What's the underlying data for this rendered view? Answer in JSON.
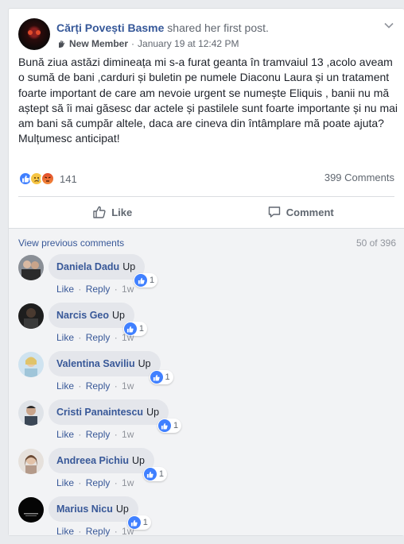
{
  "post": {
    "author": "Cărți Povești Basme",
    "action": "shared her first post.",
    "badge": "New Member",
    "separator": "·",
    "timestamp": "January 19 at 12:42 PM",
    "body": "Bună ziua astăzi dimineața mi s-a furat geanta în tramvaiul 13 ,acolo aveam o sumă de bani ,carduri și buletin pe numele Diaconu Laura și un tratament foarte important de care am nevoie urgent se numește Eliquis , banii nu mă aștept să îi mai găsesc dar actele și pastilele sunt foarte importante și nu mai am bani să cumpăr altele, daca are cineva din întâmplare mă poate ajuta?",
    "thanks": "Mulțumesc anticipat!",
    "reaction_count": "141",
    "comments_count": "399 Comments",
    "reactions": [
      "like-icon",
      "sad-icon",
      "angry-icon"
    ]
  },
  "actions": {
    "like": "Like",
    "comment": "Comment"
  },
  "comments_section": {
    "view_previous": "View previous comments",
    "page_count": "50 of 396",
    "items": [
      {
        "name": "Daniela Dadu",
        "text": "Up",
        "likes": "1",
        "like": "Like",
        "reply": "Reply",
        "time": "1w"
      },
      {
        "name": "Narcis Geo",
        "text": "Up",
        "likes": "1",
        "like": "Like",
        "reply": "Reply",
        "time": "1w"
      },
      {
        "name": "Valentina Saviliu",
        "text": "Up",
        "likes": "1",
        "like": "Like",
        "reply": "Reply",
        "time": "1w"
      },
      {
        "name": "Cristi Panaintescu",
        "text": "Up",
        "likes": "1",
        "like": "Like",
        "reply": "Reply",
        "time": "1w"
      },
      {
        "name": "Andreea Pichiu",
        "text": "Up",
        "likes": "1",
        "like": "Like",
        "reply": "Reply",
        "time": "1w"
      },
      {
        "name": "Marius Nicu",
        "text": "Up",
        "likes": "1",
        "like": "Like",
        "reply": "Reply",
        "time": "1w"
      }
    ]
  },
  "colors": {
    "link": "#385898",
    "like_blue": "#4080ff",
    "muted": "#606770"
  }
}
